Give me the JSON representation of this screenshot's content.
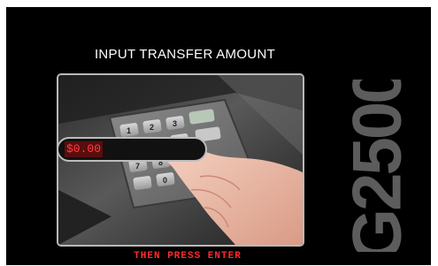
{
  "screen": {
    "title": "INPUT TRANSFER AMOUNT",
    "amount_value": "$0.00",
    "hint": "THEN PRESS ENTER",
    "model": "G2500"
  },
  "colors": {
    "background": "#000000",
    "title": "#ffffff",
    "amount_text": "#ff4040",
    "amount_highlight": "#5a0d0d",
    "hint": "#ff2a2a",
    "model_text": "#5c5c5c"
  },
  "keypad": {
    "keys": [
      "1",
      "2",
      "3",
      "4",
      "5",
      "6",
      "7",
      "8",
      "9",
      "0"
    ]
  }
}
